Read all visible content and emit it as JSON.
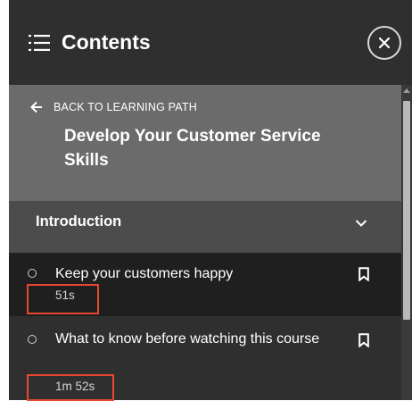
{
  "header": {
    "title": "Contents",
    "menu_icon": "list-icon",
    "close_icon": "close-icon"
  },
  "learning_path": {
    "back_label": "BACK TO LEARNING PATH",
    "back_icon": "arrow-left-icon",
    "title": "Develop Your Customer Service Skills"
  },
  "section": {
    "title": "Introduction",
    "icon": "chevron-down-icon",
    "expanded": true
  },
  "items": [
    {
      "title": "Keep your customers happy",
      "duration": "51s",
      "icon": "bookmark-icon"
    },
    {
      "title": "What to know before watching this course",
      "duration": "1m 52s",
      "icon": "bookmark-icon"
    }
  ],
  "colors": {
    "panel_bg": "#2f2f2f",
    "path_bg": "#6b6b6b",
    "section_bg": "#4c4c4c",
    "active_item_bg": "#1f1f1f",
    "highlight": "#e8472f",
    "text": "#ffffff"
  }
}
